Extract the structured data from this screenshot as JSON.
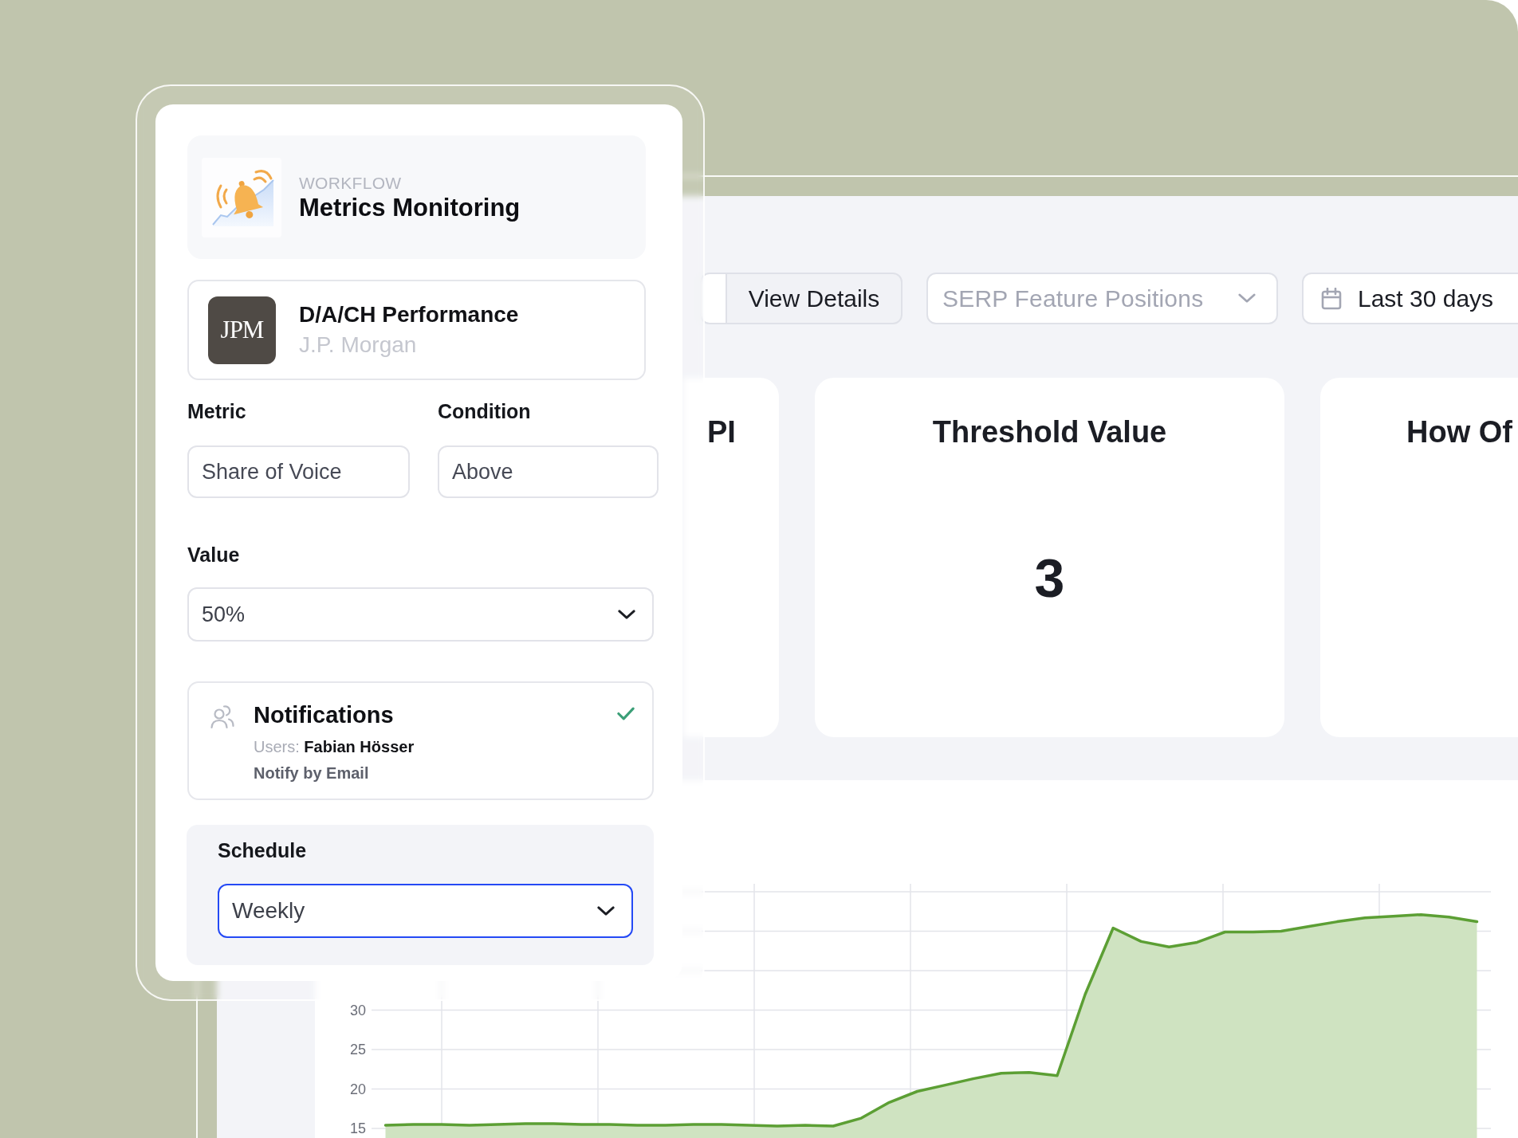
{
  "workflow": {
    "eyebrow": "WORKFLOW",
    "title": "Metrics Monitoring"
  },
  "account": {
    "logo": "JPM",
    "name": "D/A/CH Performance",
    "company": "J.P. Morgan"
  },
  "fields": [
    {
      "label": "Metric",
      "value": "Share of Voice"
    },
    {
      "label": "Condition",
      "value": "Above"
    }
  ],
  "value_select": {
    "label": "Value",
    "value": "50%",
    "focused": false
  },
  "notifications": {
    "title": "Notifications",
    "users": "Users: **Fabian Hösser**",
    "method": "Notify by Email",
    "checked": true
  },
  "schedule": {
    "label": "Schedule",
    "value": "Weekly",
    "focused": true
  },
  "dashboard": {
    "toolbar": {
      "segments": [
        {
          "selected": true
        },
        {
          "label": "View Details",
          "selected": false
        }
      ],
      "metric_dropdown": {
        "placeholder": "SERP Feature Positions"
      },
      "date_range": {
        "label": "Last 30 days"
      }
    },
    "kpi_cards": [
      {
        "title": "PI"
      },
      {
        "title": "Threshold Value",
        "value": "3"
      },
      {
        "title": "How Of"
      }
    ],
    "chart": {
      "chart_data": {
        "type": "area",
        "categories": [
          null,
          null,
          null,
          null,
          null,
          null,
          null,
          null,
          null,
          null,
          null,
          null,
          null,
          null,
          null,
          null,
          null,
          null,
          null,
          null,
          null,
          null,
          null,
          null,
          null,
          null,
          null,
          null,
          null,
          null,
          null,
          null,
          null,
          null,
          null,
          null,
          null,
          null,
          null,
          null
        ],
        "values": [
          15.4,
          15.5,
          15.5,
          15.4,
          15.5,
          15.6,
          15.6,
          15.5,
          15.5,
          15.4,
          15.4,
          15.5,
          15.5,
          15.4,
          15.3,
          15.4,
          15.3,
          16.3,
          18.3,
          19.7,
          20.5,
          21.3,
          22,
          22.1,
          21.7,
          32,
          40.4,
          38.7,
          38,
          38.6,
          39.9,
          39.9,
          40,
          40.6,
          41.2,
          41.7,
          41.9,
          42.1,
          41.8,
          41.2
        ],
        "ylim": [
          15,
          45
        ],
        "yticks": [
          15,
          20,
          25,
          30
        ],
        "grid": true
      }
    }
  }
}
